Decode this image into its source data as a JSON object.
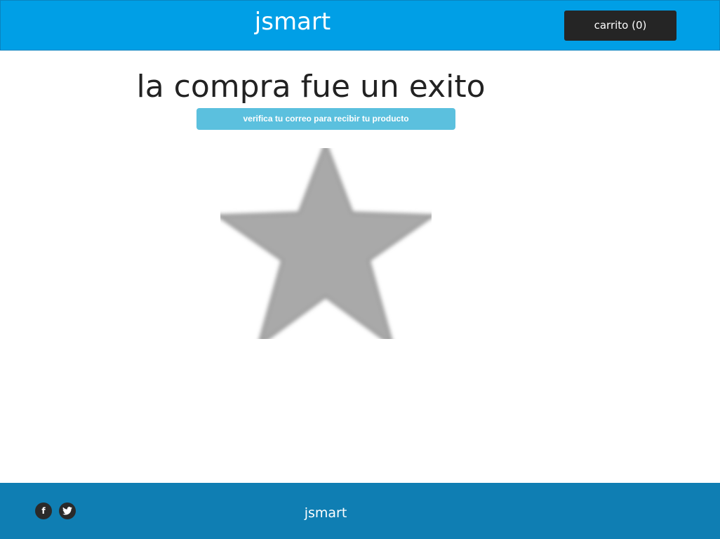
{
  "header": {
    "brand": "jsmart",
    "cart_label": "carrito (0)"
  },
  "main": {
    "title": "la compra fue un exito",
    "notice": "verifica tu correo para recibir tu producto",
    "image_icon": "star-icon"
  },
  "footer": {
    "brand": "jsmart",
    "social": [
      {
        "icon": "facebook-icon",
        "glyph": "f"
      },
      {
        "icon": "twitter-icon"
      }
    ]
  },
  "colors": {
    "header_bg": "#009fe6",
    "cart_bg": "#252525",
    "notice_bg": "#5bc0de",
    "footer_bg": "#0f7eb3",
    "star": "#a9a9a9"
  }
}
